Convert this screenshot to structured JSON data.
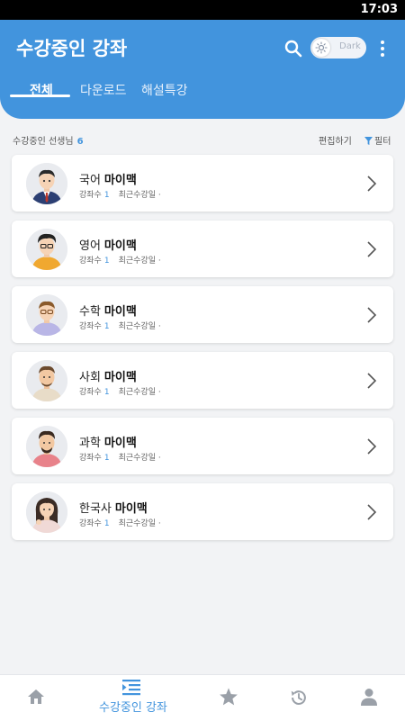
{
  "status_bar": {
    "time": "17:03"
  },
  "header": {
    "title": "수강중인 강좌",
    "theme_label": "Dark",
    "tabs": [
      "전체",
      "다운로드",
      "해설특강"
    ]
  },
  "list": {
    "label": "수강중인 선생님",
    "count": "6",
    "edit_label": "편집하기",
    "filter_label": "필터"
  },
  "courses": [
    {
      "subject": "국어",
      "teacher": "마이맥",
      "lecture_count_label": "강좌수",
      "lecture_count": "1",
      "recent_label": "최근수강일 ·"
    },
    {
      "subject": "영어",
      "teacher": "마이맥",
      "lecture_count_label": "강좌수",
      "lecture_count": "1",
      "recent_label": "최근수강일 ·"
    },
    {
      "subject": "수학",
      "teacher": "마이맥",
      "lecture_count_label": "강좌수",
      "lecture_count": "1",
      "recent_label": "최근수강일 ·"
    },
    {
      "subject": "사회",
      "teacher": "마이맥",
      "lecture_count_label": "강좌수",
      "lecture_count": "1",
      "recent_label": "최근수강일 ·"
    },
    {
      "subject": "과학",
      "teacher": "마이맥",
      "lecture_count_label": "강좌수",
      "lecture_count": "1",
      "recent_label": "최근수강일 ·"
    },
    {
      "subject": "한국사",
      "teacher": "마이맥",
      "lecture_count_label": "강좌수",
      "lecture_count": "1",
      "recent_label": "최근수강일 ·"
    }
  ],
  "bottom_nav": {
    "active_label": "수강중인 강좌",
    "items": [
      "home-icon",
      "my-courses-icon",
      "star-icon",
      "history-icon",
      "profile-icon"
    ]
  },
  "colors": {
    "primary": "#4294dd",
    "background": "#f2f3f5",
    "card": "#ffffff"
  }
}
